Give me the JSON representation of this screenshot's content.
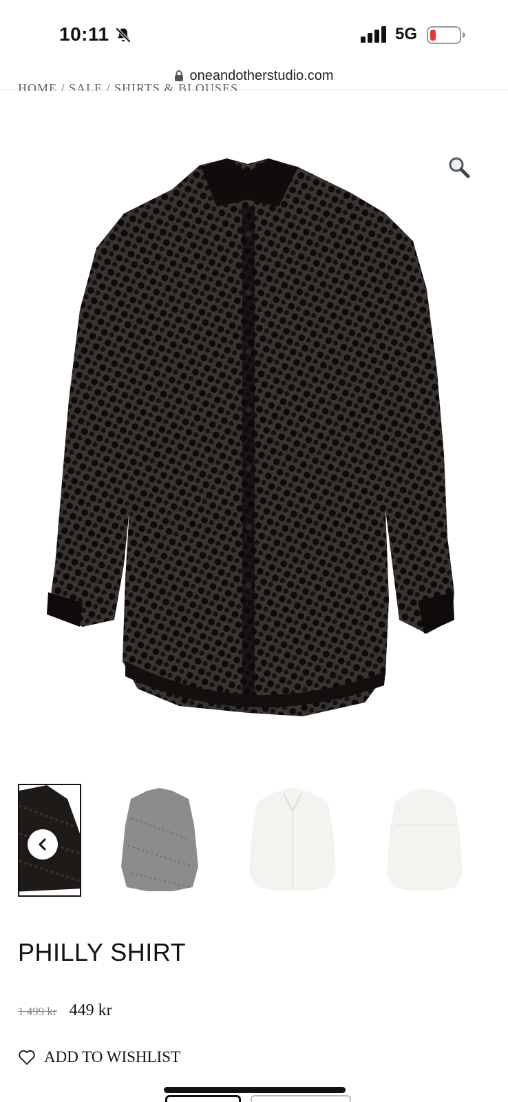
{
  "status_bar": {
    "time": "10:11",
    "network": "5G"
  },
  "browser": {
    "url": "oneandotherstudio.com"
  },
  "breadcrumb": "HOME / SALE / SHIRTS & BLOUSES",
  "product": {
    "title": "PHILLY SHIRT",
    "old_price": "1 499 kr",
    "price": "449 kr",
    "wishlist_label": "ADD TO WISHLIST"
  },
  "thumbnails": [
    {
      "color": "black",
      "active": true
    },
    {
      "color": "grey",
      "active": false
    },
    {
      "color": "white",
      "active": false
    },
    {
      "color": "white",
      "active": false
    }
  ],
  "colors": {
    "shirt_black": "#1e1a18",
    "shirt_grey": "#8c8c8c",
    "shirt_white": "#f4f3f0",
    "battery_low": "#e53935"
  },
  "icons": [
    "bell-slash-icon",
    "signal-icon",
    "battery-icon",
    "lock-icon",
    "zoom-icon",
    "chevron-left-icon",
    "heart-icon"
  ]
}
